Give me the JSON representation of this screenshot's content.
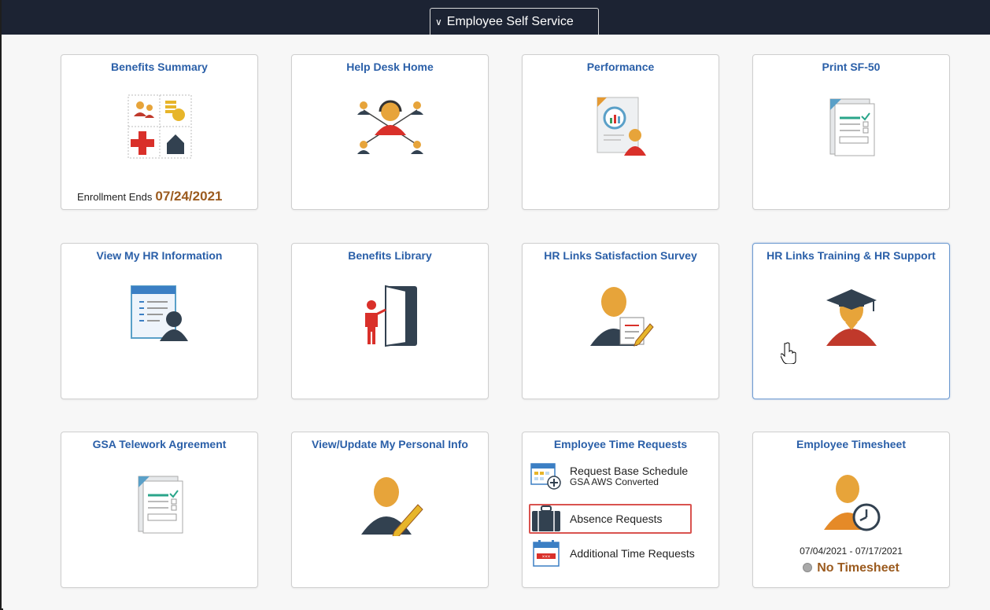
{
  "topbar": {
    "homepage_label": "Employee Self Service"
  },
  "tiles": [
    {
      "title": "Benefits Summary",
      "footer_label": "Enrollment Ends",
      "footer_value": "07/24/2021"
    },
    {
      "title": "Help Desk Home"
    },
    {
      "title": "Performance"
    },
    {
      "title": "Print SF-50"
    },
    {
      "title": "View My HR Information"
    },
    {
      "title": "Benefits Library"
    },
    {
      "title": "HR Links Satisfaction Survey"
    },
    {
      "title": "HR Links Training & HR Support"
    },
    {
      "title": "GSA Telework Agreement"
    },
    {
      "title": "View/Update My Personal Info"
    },
    {
      "title": "Employee Time Requests",
      "items": [
        {
          "label": "Request Base Schedule",
          "sublabel": "GSA AWS Converted"
        },
        {
          "label": "Absence Requests"
        },
        {
          "label": "Additional Time Requests"
        }
      ]
    },
    {
      "title": "Employee Timesheet",
      "period": "07/04/2021 - 07/17/2021",
      "status": "No Timesheet"
    }
  ],
  "colors": {
    "title_blue": "#2a5fa8",
    "accent_brown": "#9b5b1f",
    "header_dark": "#1c2333",
    "highlight_red": "#d9534f"
  }
}
